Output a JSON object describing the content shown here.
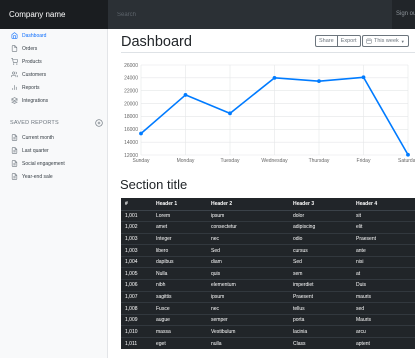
{
  "navbar": {
    "brand": "Company name",
    "search_placeholder": "Search",
    "signout": "Sign ou"
  },
  "sidebar": {
    "items": [
      {
        "label": "Dashboard",
        "icon": "home-icon",
        "active": true
      },
      {
        "label": "Orders",
        "icon": "file-icon",
        "active": false
      },
      {
        "label": "Products",
        "icon": "cart-icon",
        "active": false
      },
      {
        "label": "Customers",
        "icon": "users-icon",
        "active": false
      },
      {
        "label": "Reports",
        "icon": "bar-chart-icon",
        "active": false
      },
      {
        "label": "Integrations",
        "icon": "layers-icon",
        "active": false
      }
    ],
    "saved_heading": "SAVED REPORTS",
    "saved_items": [
      {
        "label": "Current month",
        "icon": "file-text-icon"
      },
      {
        "label": "Last quarter",
        "icon": "file-text-icon"
      },
      {
        "label": "Social engagement",
        "icon": "file-text-icon"
      },
      {
        "label": "Year-end sale",
        "icon": "file-text-icon"
      }
    ]
  },
  "main": {
    "title": "Dashboard",
    "share_label": "Share",
    "export_label": "Export",
    "week_label": "This week",
    "section_title": "Section title"
  },
  "colors": {
    "accent": "#007bff",
    "navbar": "#212529",
    "table_bg": "#212529"
  },
  "chart_data": {
    "type": "line",
    "categories": [
      "Sunday",
      "Monday",
      "Tuesday",
      "Wednesday",
      "Thursday",
      "Friday",
      "Saturday"
    ],
    "values": [
      15339,
      21345,
      18483,
      24003,
      23489,
      24092,
      12034
    ],
    "ylim": [
      12000,
      26000
    ],
    "yticks": [
      "12000",
      "14000",
      "16000",
      "18000",
      "20000",
      "22000",
      "24000",
      "26000"
    ],
    "grid": true,
    "color": "#007bff"
  },
  "table": {
    "headers": [
      "#",
      "Header 1",
      "Header 2",
      "Header 3",
      "Header 4"
    ],
    "rows": [
      [
        "1,001",
        "Lorem",
        "ipsum",
        "dolor",
        "sit"
      ],
      [
        "1,002",
        "amet",
        "consectetur",
        "adipiscing",
        "elit"
      ],
      [
        "1,003",
        "Integer",
        "nec",
        "odio",
        "Praesent"
      ],
      [
        "1,003",
        "libero",
        "Sed",
        "cursus",
        "ante"
      ],
      [
        "1,004",
        "dapibus",
        "diam",
        "Sed",
        "nisi"
      ],
      [
        "1,005",
        "Nulla",
        "quis",
        "sem",
        "at"
      ],
      [
        "1,006",
        "nibh",
        "elementum",
        "imperdiet",
        "Duis"
      ],
      [
        "1,007",
        "sagittis",
        "ipsum",
        "Praesent",
        "mauris"
      ],
      [
        "1,008",
        "Fusce",
        "nec",
        "tellus",
        "sed"
      ],
      [
        "1,009",
        "augue",
        "semper",
        "porta",
        "Mauris"
      ],
      [
        "1,010",
        "massa",
        "Vestibulum",
        "lacinia",
        "arcu"
      ],
      [
        "1,011",
        "eget",
        "nulla",
        "Class",
        "aptent"
      ]
    ]
  }
}
